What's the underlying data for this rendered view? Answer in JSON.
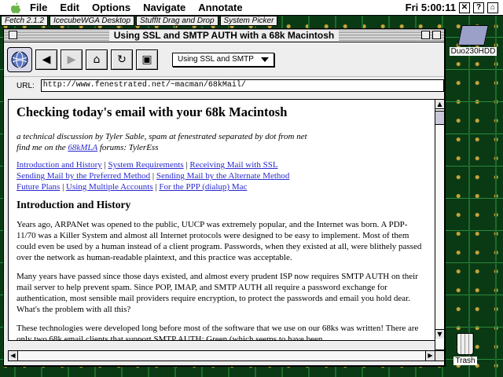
{
  "menubar": {
    "items": [
      "File",
      "Edit",
      "Options",
      "Navigate",
      "Annotate"
    ],
    "clock": "Fri 5:00:11"
  },
  "app_strip": [
    "Fetch 2.1.2",
    "IcecubeWGA Desktop",
    "StuffIt Drag and Drop",
    "System Picker"
  ],
  "desktop": {
    "disk_label": "Duo230HDD",
    "trash_label": "Trash"
  },
  "window": {
    "title": "Using SSL and SMTP AUTH with a 68k Macintosh",
    "dropdown_value": "Using SSL and SMTP",
    "url_label": "URL:",
    "url_value": "http://www.fenestrated.net/~macman/68kMail/"
  },
  "page": {
    "heading": "Checking today's email with your 68k Macintosh",
    "byline_1": "a technical discussion by Tyler Sable, spam at fenestrated separated by dot from net",
    "byline_2_pre": "find me on the ",
    "byline_2_link": "68kMLA",
    "byline_2_post": " forums: TylerEss",
    "nav": [
      [
        "Introduction and History",
        "System Requirements",
        "Receiving Mail with SSL"
      ],
      [
        "Sending Mail by the Preferred Method",
        "Sending Mail by the Alternate Method"
      ],
      [
        "Future Plans",
        "Using Multiple Accounts",
        "For the PPP (dialup) Mac"
      ]
    ],
    "section_heading": "Introduction and History",
    "paragraphs": [
      "Years ago, ARPANet was opened to the public, UUCP was extremely popular, and the Internet was born. A PDP-11/70 was a Killer System and almost all Internet protocols were designed to be easy to implement. Most of them could even be used by a human instead of a client program. Passwords, when they existed at all, were blithely passed over the network as human-readable plaintext, and this practice was acceptable.",
      "Many years have passed since those days existed, and almost every prudent ISP now requires SMTP AUTH on their mail server to help prevent spam. Since POP, IMAP, and SMTP AUTH all require a password exchange for authentication, most sensible mail providers require encryption, to protect the passwords and email you hold dear. What's the problem with all this?",
      "These technologies were developed long before most of the software that we use on our 68ks was written! There are only two 68k email clients that support SMTP AUTH: Green (which seems to have been"
    ]
  },
  "colors": {
    "link": "#2a2ad0",
    "desktop_bg": "#0a3a14"
  }
}
